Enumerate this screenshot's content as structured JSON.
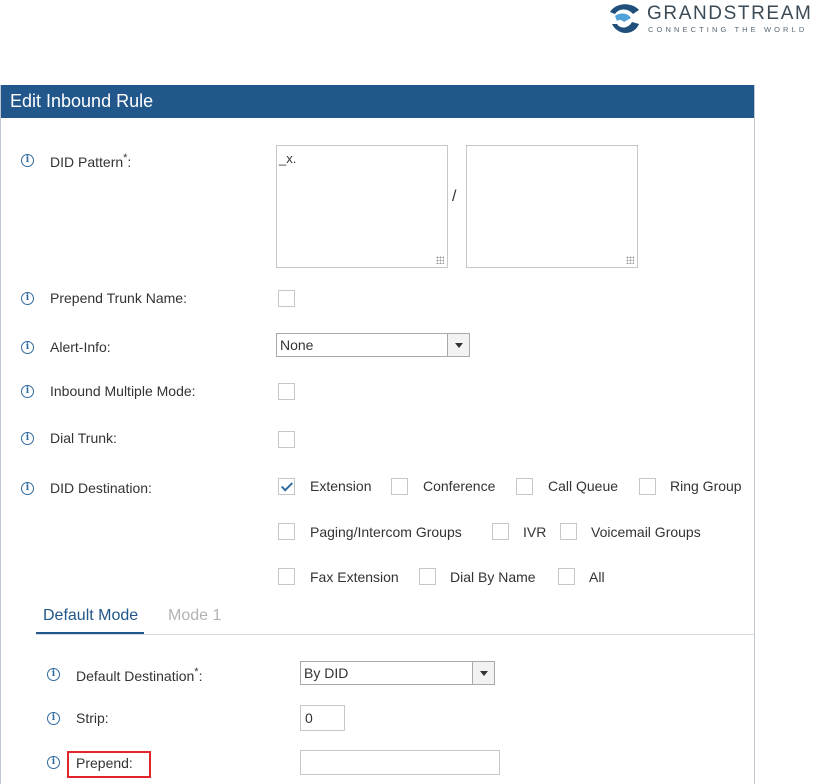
{
  "brand": {
    "name": "GRANDSTREAM",
    "tagline": "CONNECTING THE WORLD"
  },
  "dialog": {
    "title": "Edit Inbound Rule"
  },
  "form": {
    "did_pattern": {
      "label": "DID Pattern",
      "required": "*",
      "colon": ":",
      "left_value": "_x.",
      "right_value": "",
      "separator": "/"
    },
    "prepend_trunk_name": {
      "label": "Prepend Trunk Name:",
      "checked": false
    },
    "alert_info": {
      "label": "Alert-Info:",
      "value": "None"
    },
    "inbound_multiple_mode": {
      "label": "Inbound Multiple Mode:",
      "checked": false
    },
    "dial_trunk": {
      "label": "Dial Trunk:",
      "checked": false
    },
    "did_destination": {
      "label": "DID Destination:",
      "options": [
        {
          "label": "Extension",
          "checked": true
        },
        {
          "label": "Conference",
          "checked": false
        },
        {
          "label": "Call Queue",
          "checked": false
        },
        {
          "label": "Ring Group",
          "checked": false
        },
        {
          "label": "Paging/Intercom Groups",
          "checked": false
        },
        {
          "label": "IVR",
          "checked": false
        },
        {
          "label": "Voicemail Groups",
          "checked": false
        },
        {
          "label": "Fax Extension",
          "checked": false
        },
        {
          "label": "Dial By Name",
          "checked": false
        },
        {
          "label": "All",
          "checked": false
        }
      ]
    }
  },
  "tabs": {
    "default_mode": "Default Mode",
    "mode_1": "Mode 1"
  },
  "mode_form": {
    "default_destination": {
      "label": "Default Destination",
      "required": "*",
      "colon": ":",
      "value": "By DID"
    },
    "strip": {
      "label": "Strip:",
      "value": "0"
    },
    "prepend": {
      "label": "Prepend:",
      "value": ""
    }
  },
  "colors": {
    "title_bar": "#21578a",
    "info_icon": "#2f6aa0",
    "highlight": "#e2242b"
  }
}
